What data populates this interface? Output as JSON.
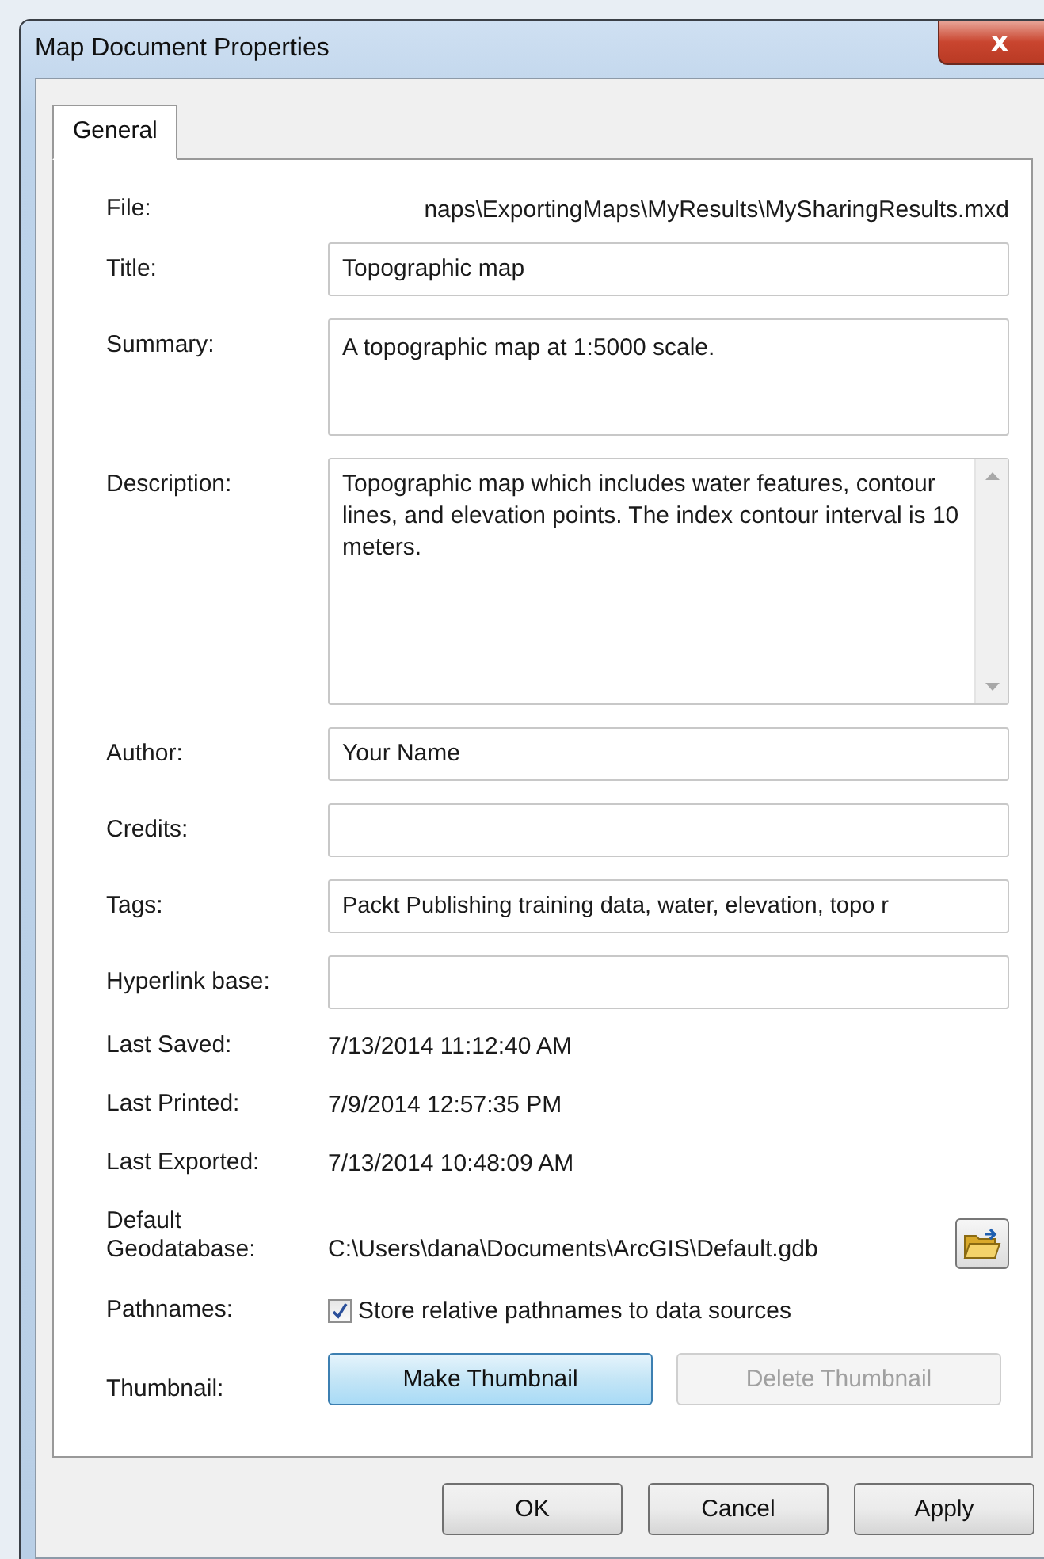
{
  "window": {
    "title": "Map Document Properties",
    "close": "x"
  },
  "tabs": [
    {
      "label": "General",
      "selected": true
    }
  ],
  "rows": [
    {
      "kind": "path",
      "label": "File:",
      "value": "naps\\ExportingMaps\\MyResults\\MySharingResults.mxd"
    },
    {
      "kind": "input",
      "label": "Title:",
      "value": "Topographic map"
    },
    {
      "kind": "multiline",
      "label": "Summary:",
      "value": "A topographic map at 1:5000 scale."
    },
    {
      "kind": "scrolling",
      "label": "Description:",
      "value": "Topographic map which includes water features, contour lines, and elevation points. The index contour interval is 10 meters."
    },
    {
      "kind": "input",
      "label": "Author:",
      "value": "Your Name"
    },
    {
      "kind": "input",
      "label": "Credits:",
      "value": ""
    },
    {
      "kind": "input",
      "label": "Tags:",
      "value": "Packt Publishing training data, water, elevation, topo r"
    },
    {
      "kind": "input",
      "label": "Hyperlink base:",
      "value": ""
    },
    {
      "kind": "info",
      "label": "Last Saved:",
      "value": "7/13/2014 11:12:40 AM"
    },
    {
      "kind": "info",
      "label": "Last Printed:",
      "value": "7/9/2014 12:57:35 PM"
    },
    {
      "kind": "info",
      "label": "Last Exported:",
      "value": "7/13/2014 10:48:09 AM"
    },
    {
      "kind": "geodatabase",
      "label": "Default Geodatabase:",
      "value": "C:\\Users\\dana\\Documents\\ArcGIS\\Default.gdb"
    },
    {
      "kind": "checkbox",
      "label": "Pathnames:",
      "value": "Store relative pathnames to data sources",
      "checked": true
    },
    {
      "kind": "thumbnail",
      "label": "Thumbnail:",
      "buttons": [
        {
          "label": "Make Thumbnail",
          "disabled": false
        },
        {
          "label": "Delete Thumbnail",
          "disabled": true
        }
      ]
    }
  ],
  "buttons": [
    "OK",
    "Cancel",
    "Apply"
  ]
}
